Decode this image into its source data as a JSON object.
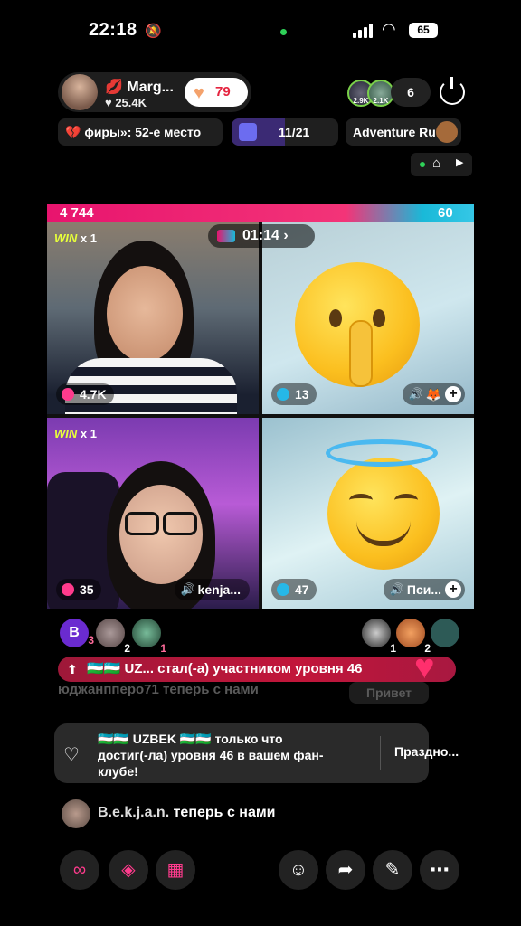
{
  "status_bar": {
    "time": "22:18",
    "battery": "65"
  },
  "host": {
    "name": "💋 Marg...",
    "likes": "♥ 25.4K",
    "follow_count": "79"
  },
  "viewers": {
    "v1": "2.9K",
    "v2": "2.1K",
    "count": "6"
  },
  "chips": {
    "rank": "ɸиры»: 52-е место",
    "progress": "11/21",
    "progress_fraction": 0.5,
    "adventure": "Adventure Ru"
  },
  "battle": {
    "left_score": "4 744",
    "right_score": "60",
    "timer": "01:14"
  },
  "cells": {
    "c1": {
      "win": "WIN",
      "mult": "x 1",
      "count": "4.7K"
    },
    "c2": {
      "count": "13",
      "name": "🦊"
    },
    "c3": {
      "win": "WIN",
      "mult": "x 1",
      "count": "35",
      "name": "kenja..."
    },
    "c4": {
      "count": "47",
      "name": "Пси..."
    }
  },
  "gifters_left": [
    {
      "label": "B",
      "rank": "3"
    },
    {
      "label": "",
      "rank": "2"
    },
    {
      "label": "",
      "rank": "1"
    }
  ],
  "gifters_right": [
    {
      "rank": "1"
    },
    {
      "rank": "2"
    },
    {
      "rank": ""
    }
  ],
  "banner": {
    "text": "🇺🇿🇺🇿 UZ... стал(-а) участником уровня 46"
  },
  "ghost": {
    "text": "юджанпперо71 теперь с нами",
    "btn": "Привет"
  },
  "notice": {
    "text": "🇺🇿🇺🇿 UZBEK 🇺🇿🇺🇿 только что достиг(-ла) уровня 46 в вашем фан-клубе!",
    "action": "Праздно..."
  },
  "joined": {
    "user": "B.e.k.j.a.n.",
    "text": " теперь с нами"
  },
  "colors": {
    "battle_left": "#e8146e",
    "battle_right": "#19b9d8",
    "win": "#e7ff3a"
  }
}
